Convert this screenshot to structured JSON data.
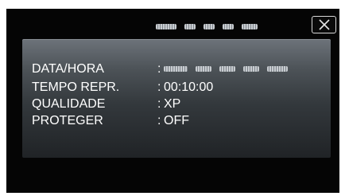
{
  "header": {
    "title_masked": true
  },
  "close_button": {
    "icon": "close-icon"
  },
  "info": {
    "rows": [
      {
        "label": "DATA/HORA",
        "colon": ":",
        "value": "",
        "masked": true
      },
      {
        "label": "TEMPO REPR.",
        "colon": ":",
        "value": "00:10:00"
      },
      {
        "label": "QUALIDADE",
        "colon": ":",
        "value": "XP"
      },
      {
        "label": "PROTEGER",
        "colon": ":",
        "value": "OFF"
      }
    ]
  },
  "colors": {
    "background": "#050505",
    "panel_top": "#6d737a",
    "panel_bottom": "#202326",
    "text": "#ffffff"
  }
}
